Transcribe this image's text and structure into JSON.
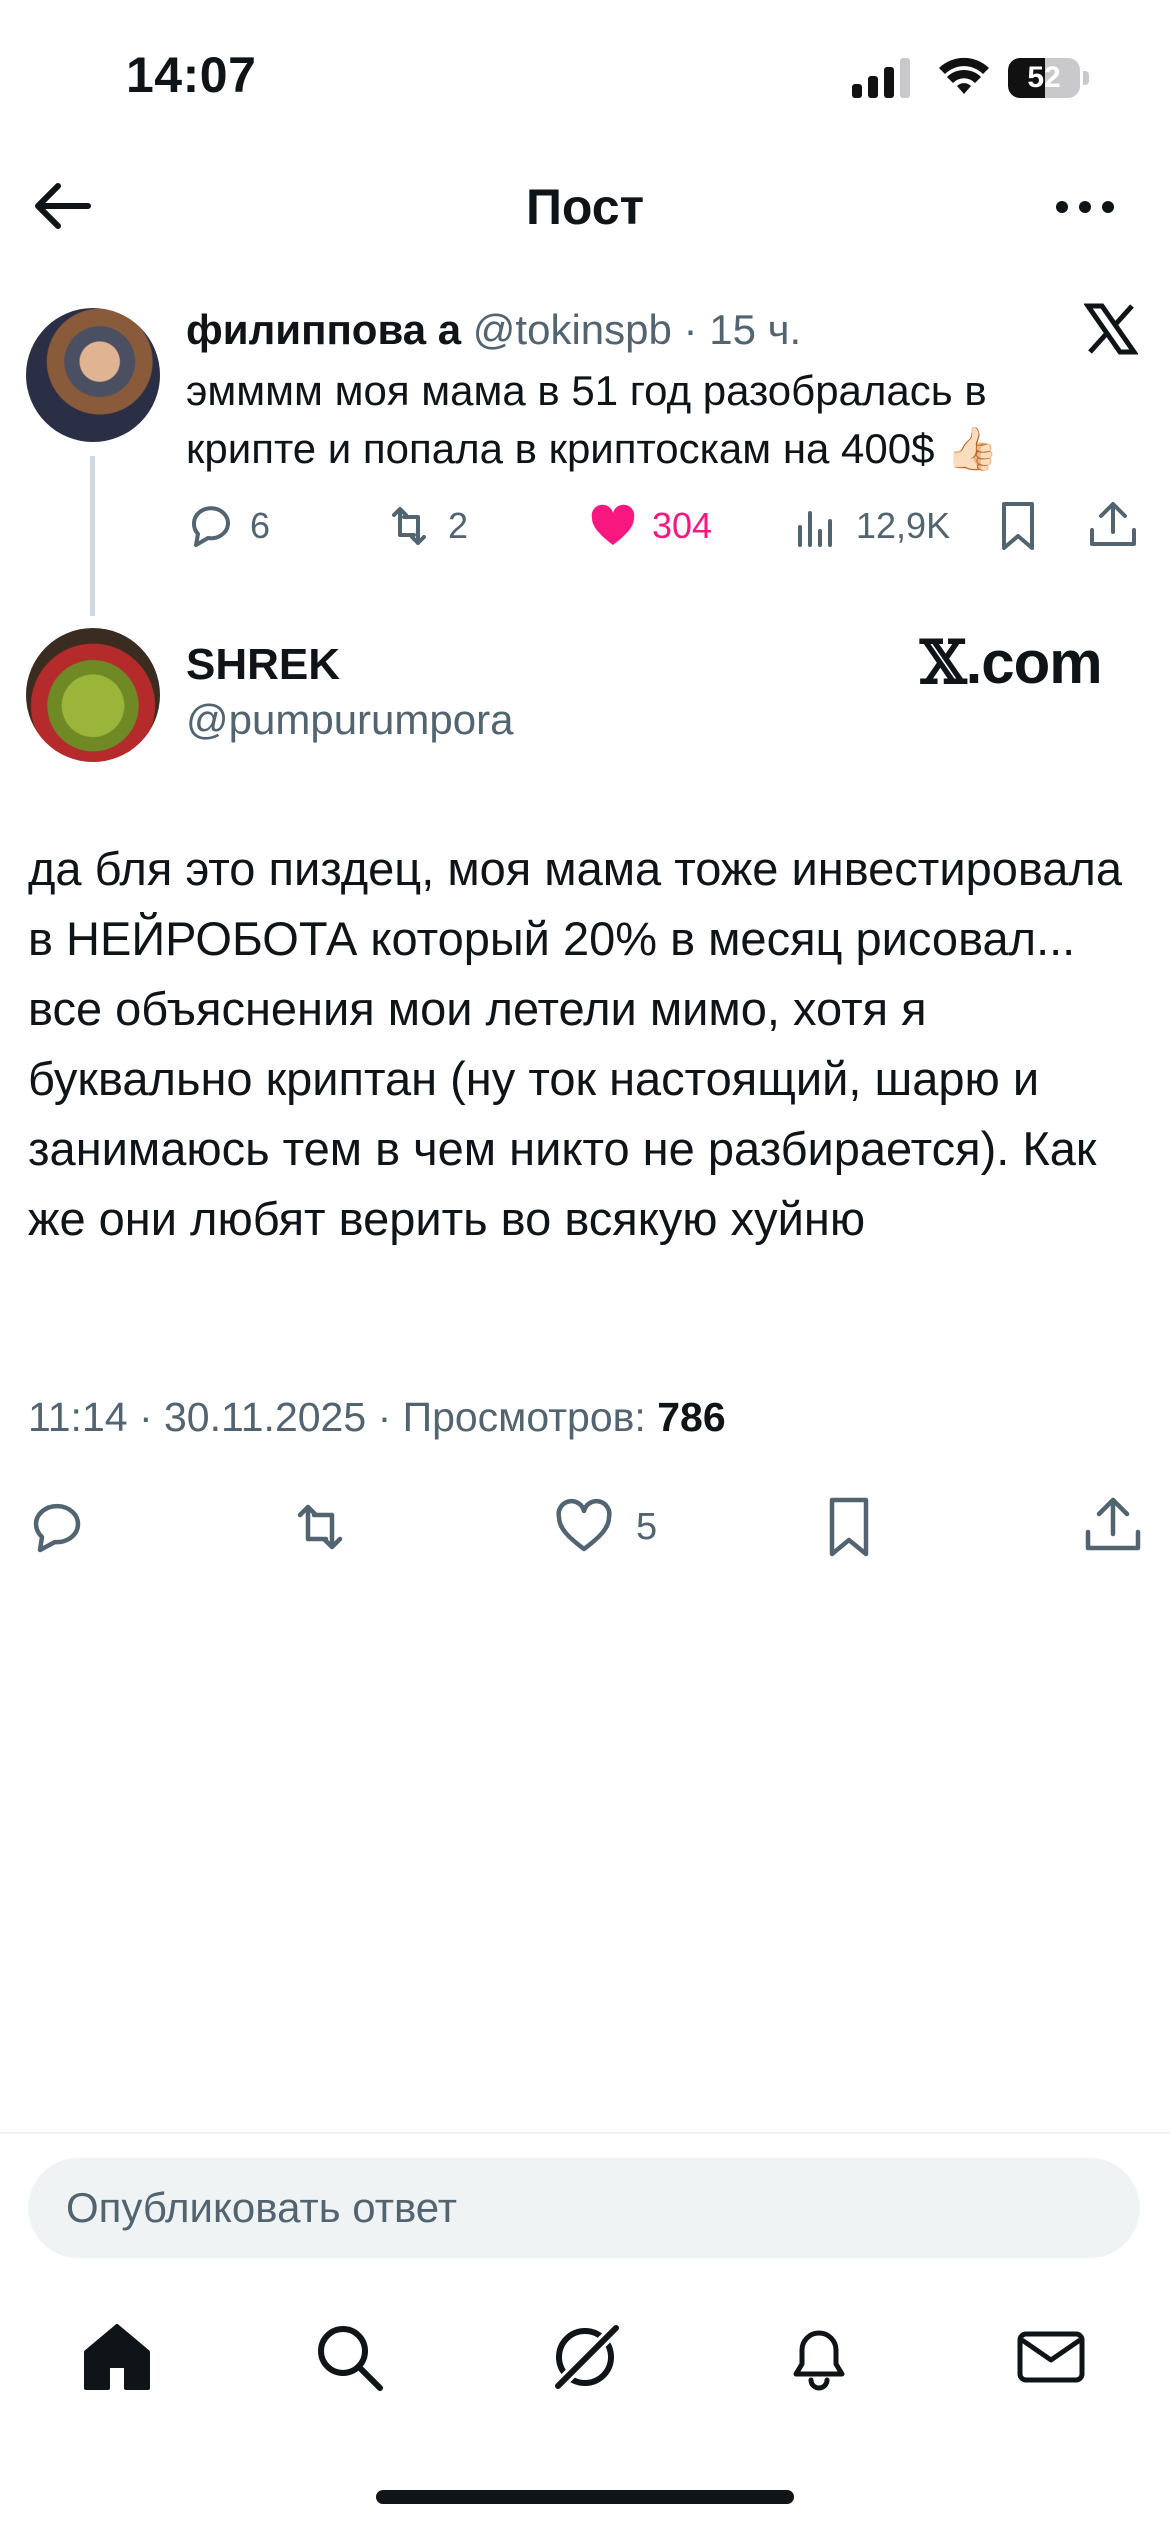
{
  "status_bar": {
    "time": "14:07",
    "battery": "52",
    "battery_level": 0.52
  },
  "header": {
    "title": "Пост"
  },
  "quoted_tweet": {
    "name": "филиппова а",
    "handle": "@tokinspb",
    "separator": "·",
    "age": "15 ч.",
    "text": "эмммм моя мама в 51 год разобралась в крипте и попала в криптоскам на 400$ 👍🏻",
    "replies": "6",
    "reposts": "2",
    "likes": "304",
    "views": "12,9K"
  },
  "tweet": {
    "author_name": "SHREK",
    "author_handle": "@pumpurumpora",
    "watermark_mark": "𝕏",
    "watermark_domain": ".com",
    "text": "да бля это пиздец, моя мама тоже инвестировала в НЕЙРОБОТА который 20% в месяц рисовал... все объяснения мои летели мимо, хотя я буквально криптан (ну ток настоящий, шарю и занимаюсь тем в чем никто не разбирается). Как же они любят верить во всякую хуйню",
    "time": "11:14",
    "date": "30.11.2025",
    "views_label": "Просмотров:",
    "views": "786",
    "likes": "5"
  },
  "reply": {
    "placeholder": "Опубликовать ответ"
  },
  "colors": {
    "accent_like": "#f91880",
    "muted": "#536471",
    "text": "#0f1419"
  },
  "icons": {
    "back": "arrow-left-icon",
    "more": "more-icon",
    "reply": "reply-icon",
    "repost": "repost-icon",
    "like": "heart-icon",
    "views": "views-icon",
    "bookmark": "bookmark-icon",
    "share": "share-icon",
    "home": "home-icon",
    "search": "search-icon",
    "grok": "grok-icon",
    "notifications": "bell-icon",
    "messages": "mail-icon"
  }
}
